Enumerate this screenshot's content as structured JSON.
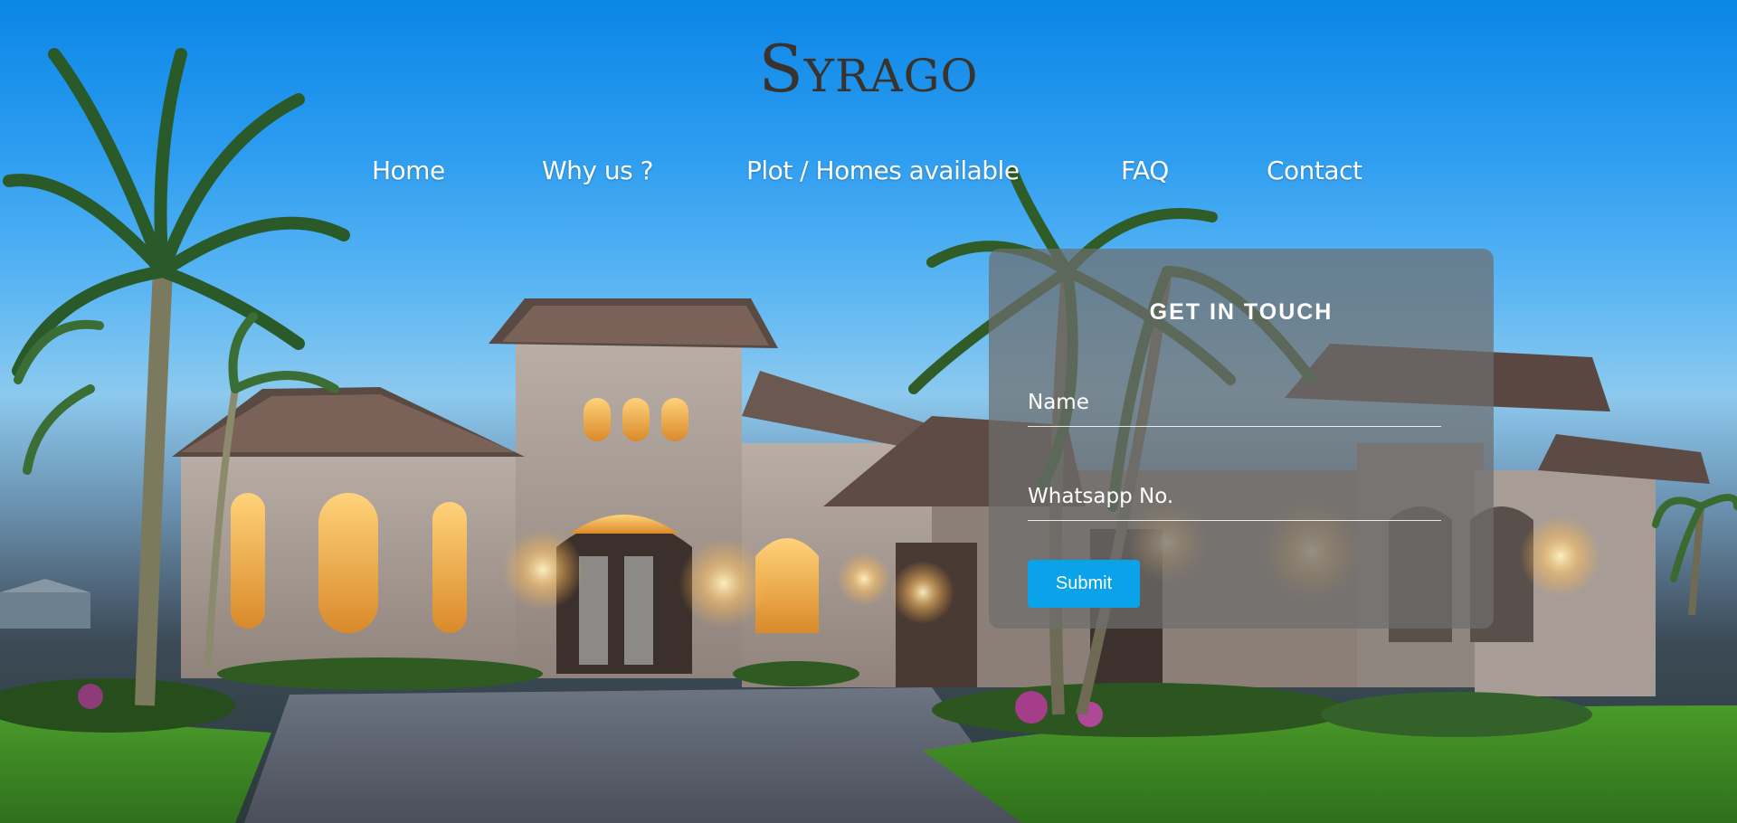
{
  "brand": {
    "logo_text": "Syrago"
  },
  "nav": {
    "items": [
      {
        "label": "Home"
      },
      {
        "label": "Why us ?"
      },
      {
        "label": "Plot / Homes available"
      },
      {
        "label": "FAQ"
      },
      {
        "label": "Contact"
      }
    ]
  },
  "contact_form": {
    "title": "GET IN TOUCH",
    "name_placeholder": "Name",
    "whatsapp_placeholder": "Whatsapp No.",
    "submit_label": "Submit"
  },
  "colors": {
    "sky": "#0a86e6",
    "logo": "#3a322c",
    "card_bg": "#6e6e6e",
    "submit_bg": "#0aa2e8",
    "text_white": "#ffffff"
  }
}
